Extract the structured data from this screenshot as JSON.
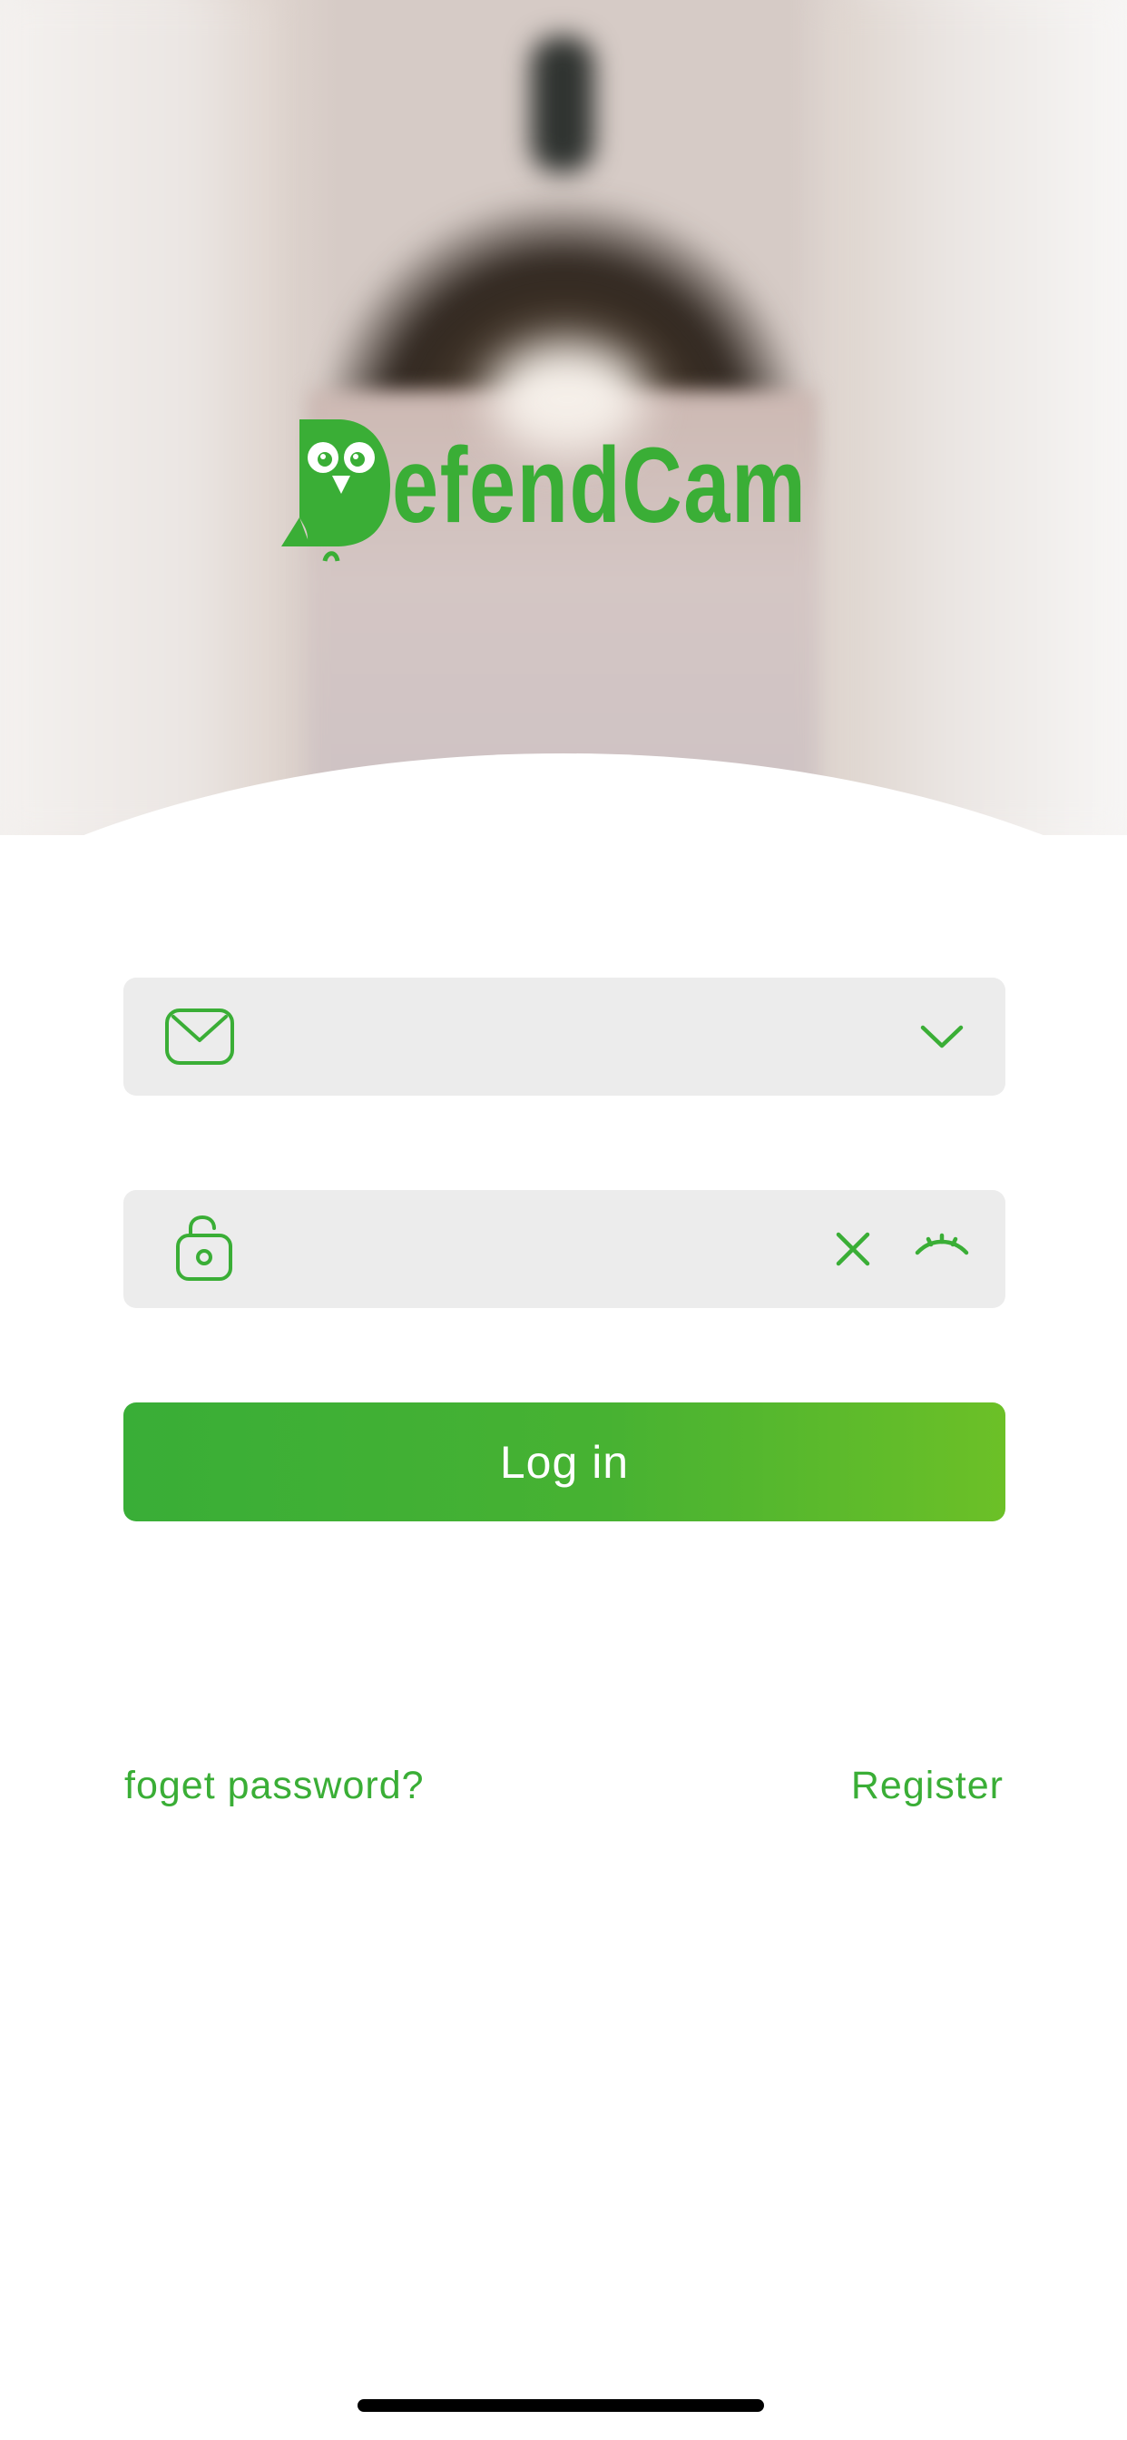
{
  "logo": {
    "brand_text": "efendCam",
    "brand_color": "#3aae36"
  },
  "email_field": {
    "leading_icon": "mail-icon",
    "value": "",
    "placeholder": "",
    "trailing_icon": "chevron-down-icon"
  },
  "password_field": {
    "leading_icon": "lock-open-icon",
    "value": "",
    "placeholder": "",
    "clear_icon": "close-icon",
    "visibility_icon": "eye-closed-icon"
  },
  "login_button": {
    "label": "Log in",
    "gradient_start": "#39ae37",
    "gradient_end": "#6cc027"
  },
  "links": {
    "forgot_password": "foget password?",
    "register": "Register"
  },
  "accent_color": "#3aae36"
}
